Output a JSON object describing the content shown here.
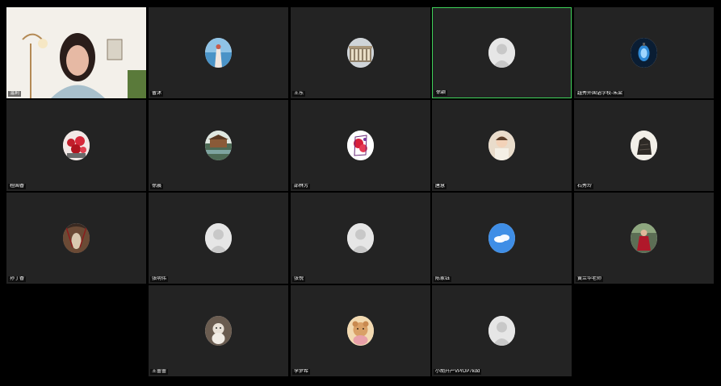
{
  "meeting": {
    "participants": [
      {
        "name": "温莉",
        "avatar": "video-feed",
        "active": false
      },
      {
        "name": "曹沐",
        "avatar": "photo-woman-by-sea",
        "active": false
      },
      {
        "name": "王东",
        "avatar": "photo-building",
        "active": false
      },
      {
        "name": "徐颖",
        "avatar": "default-person",
        "active": true
      },
      {
        "name": "越秀外国语学校-朱梁",
        "avatar": "photo-blue-lantern",
        "active": false
      },
      {
        "name": "程国香",
        "avatar": "photo-red-flowers",
        "active": false
      },
      {
        "name": "徐晨",
        "avatar": "photo-lake-house",
        "active": false
      },
      {
        "name": "邵林芳",
        "avatar": "photo-red-rose-card",
        "active": false
      },
      {
        "name": "唐慧",
        "avatar": "photo-baby",
        "active": false
      },
      {
        "name": "石秀玲",
        "avatar": "photo-rock",
        "active": false
      },
      {
        "name": "孙丁香",
        "avatar": "photo-tree-tunnel",
        "active": false
      },
      {
        "name": "张明伟",
        "avatar": "default-person",
        "active": false
      },
      {
        "name": "张悦",
        "avatar": "default-person",
        "active": false
      },
      {
        "name": "陈家钰",
        "avatar": "photo-blue-sky",
        "active": false
      },
      {
        "name": "黄兰华老师",
        "avatar": "photo-woman-red-dress",
        "active": false
      },
      {
        "name": "王蕾蕾",
        "avatar": "photo-stuffed-toy",
        "active": false
      },
      {
        "name": "李梦希",
        "avatar": "photo-teddy-bear",
        "active": false
      },
      {
        "name": "小胡升产VPrDP7kdd",
        "avatar": "default-person",
        "active": false
      }
    ],
    "colors": {
      "background": "#000000",
      "tile": "#232323",
      "active_border": "#3fd35a"
    }
  }
}
